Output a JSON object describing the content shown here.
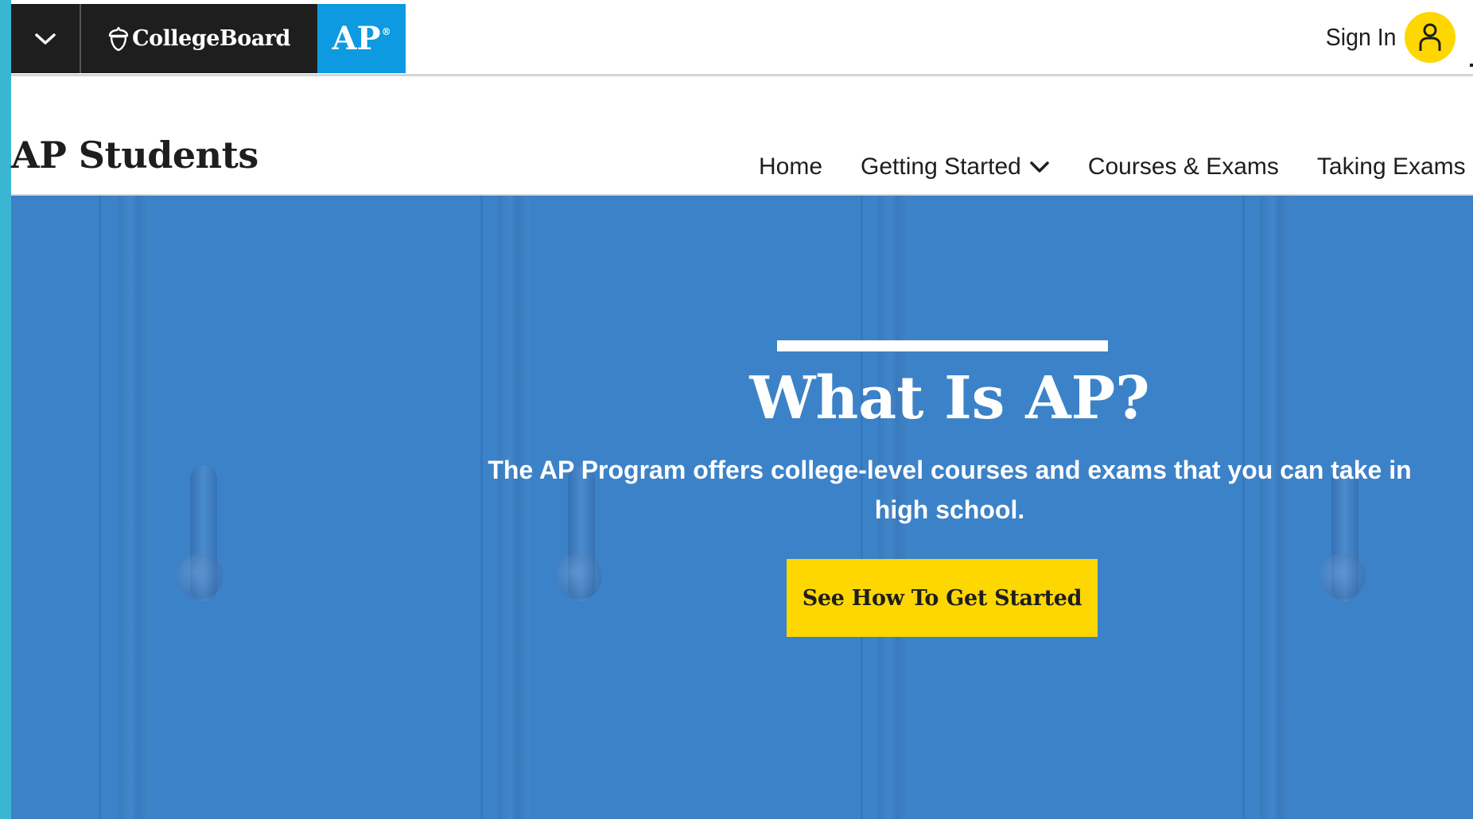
{
  "colors": {
    "brand_dark": "#1e1e1e",
    "ap_blue": "#0d9ae0",
    "hero_blue": "#3c82c8",
    "accent_yellow": "#fed700",
    "left_edge": "#3ab6d2"
  },
  "header": {
    "menu_icon": "chevron-down-icon",
    "collegeboard_logo": "CollegeBoard",
    "ap_logo": "AP",
    "ap_logo_mark": "®",
    "signin_label": "Sign In",
    "signin_icon": "user-icon"
  },
  "site": {
    "title": "AP Students"
  },
  "nav": {
    "items": [
      {
        "label": "Home",
        "has_dropdown": false,
        "active": false
      },
      {
        "label": "Getting Started",
        "has_dropdown": true,
        "active": true
      },
      {
        "label": "Courses & Exams",
        "has_dropdown": false,
        "active": false
      },
      {
        "label": "Taking Exams",
        "has_dropdown": true,
        "active": false
      }
    ]
  },
  "hero": {
    "title": "What Is AP?",
    "subtitle": "The AP Program offers college-level courses and exams that you can take in high school.",
    "cta_label": "See How To Get Started"
  }
}
